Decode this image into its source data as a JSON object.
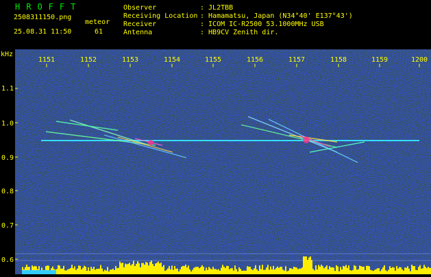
{
  "app": {
    "title": "HROFFT"
  },
  "file": {
    "name": "2508311150.png",
    "type_label": "meteor",
    "datetime": "25.08.31 11:50",
    "count": "61"
  },
  "station": {
    "rows": [
      {
        "key": "Observer",
        "value": ": JL2TBB"
      },
      {
        "key": "Receiving Location",
        "value": ": Hamamatsu, Japan (N34°40' E137°43')"
      },
      {
        "key": "Receiver",
        "value": ": ICOM IC-R2500 53.1000MHz USB"
      },
      {
        "key": "Antenna",
        "value": ": HB9CV Zenith dir."
      }
    ]
  },
  "axes": {
    "y_unit": "kHz",
    "x_ticks": [
      "1151",
      "1152",
      "1153",
      "1154",
      "1155",
      "1156",
      "1157",
      "1158",
      "1159",
      "1200"
    ],
    "y_ticks": [
      "1.1",
      "1.0",
      "0.9",
      "0.8",
      "0.7",
      "0.6"
    ]
  },
  "colors": {
    "title": "#00ee00",
    "text": "#ffff00",
    "background": "#000060",
    "carrier": "#33ddff"
  }
}
